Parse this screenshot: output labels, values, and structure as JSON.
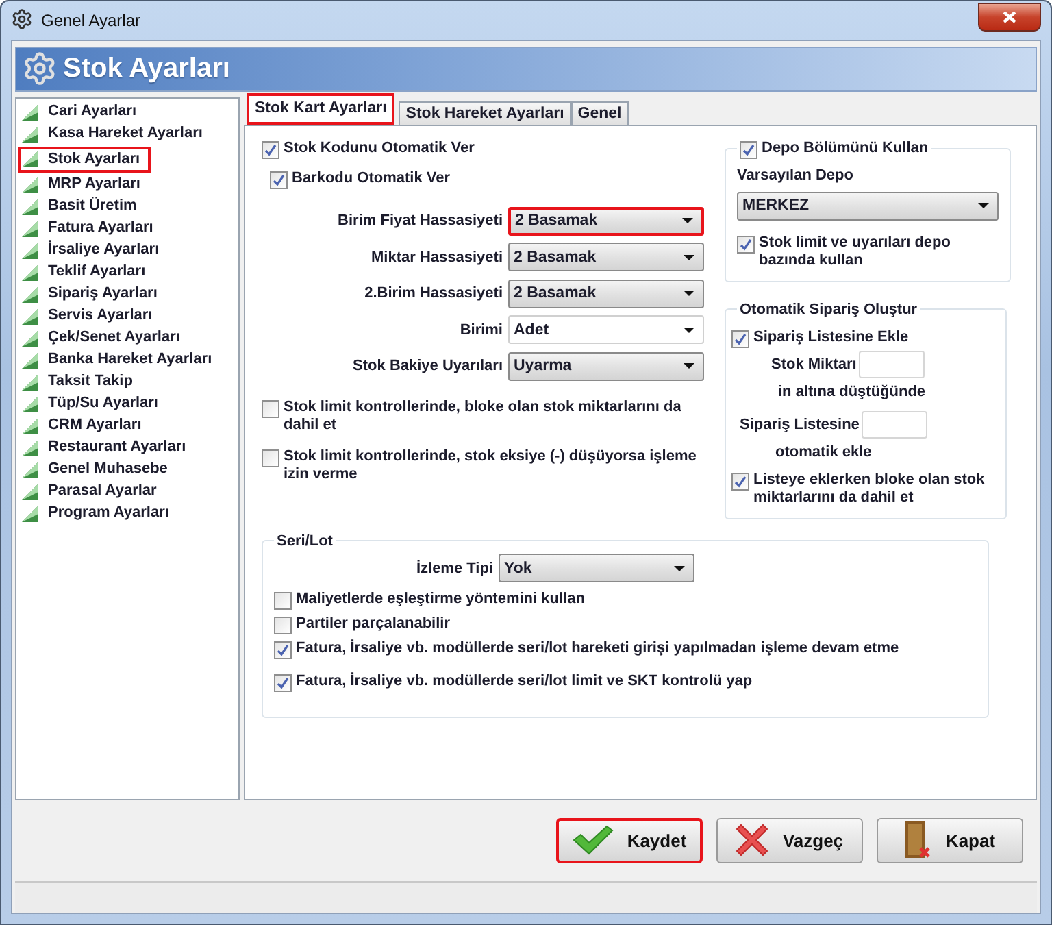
{
  "window": {
    "title": "Genel Ayarlar"
  },
  "header": {
    "title": "Stok Ayarları"
  },
  "sidebar": {
    "items": [
      {
        "label": "Cari Ayarları",
        "highlighted": false
      },
      {
        "label": "Kasa Hareket Ayarları",
        "highlighted": false
      },
      {
        "label": "Stok Ayarları",
        "highlighted": true
      },
      {
        "label": "MRP Ayarları",
        "highlighted": false
      },
      {
        "label": "Basit Üretim",
        "highlighted": false
      },
      {
        "label": "Fatura Ayarları",
        "highlighted": false
      },
      {
        "label": "İrsaliye Ayarları",
        "highlighted": false
      },
      {
        "label": "Teklif Ayarları",
        "highlighted": false
      },
      {
        "label": "Sipariş Ayarları",
        "highlighted": false
      },
      {
        "label": "Servis Ayarları",
        "highlighted": false
      },
      {
        "label": "Çek/Senet Ayarları",
        "highlighted": false
      },
      {
        "label": "Banka Hareket Ayarları",
        "highlighted": false
      },
      {
        "label": "Taksit Takip",
        "highlighted": false
      },
      {
        "label": "Tüp/Su Ayarları",
        "highlighted": false
      },
      {
        "label": "CRM Ayarları",
        "highlighted": false
      },
      {
        "label": "Restaurant Ayarları",
        "highlighted": false
      },
      {
        "label": "Genel Muhasebe",
        "highlighted": false
      },
      {
        "label": "Parasal Ayarlar",
        "highlighted": false
      },
      {
        "label": "Program Ayarları",
        "highlighted": false
      }
    ]
  },
  "tabs": [
    {
      "label": "Stok Kart Ayarları",
      "selected": true,
      "highlighted": true
    },
    {
      "label": "Stok Hareket Ayarları",
      "selected": false,
      "highlighted": false
    },
    {
      "label": "Genel",
      "selected": false,
      "highlighted": false
    }
  ],
  "general": {
    "items": [
      {
        "kind": "checkbox",
        "label": "Stok Kodunu Otomatik Ver",
        "checked": true,
        "children": [
          {
            "kind": "checkbox",
            "label": "Barkodu Otomatik Ver",
            "checked": true
          }
        ]
      },
      {
        "kind": "select",
        "label": "Birim Fiyat Hassasiyeti",
        "value": "2 Basamak",
        "editable": false,
        "highlighted": true
      },
      {
        "kind": "select",
        "label": "Miktar Hassasiyeti",
        "value": "2 Basamak",
        "editable": false,
        "highlighted": false
      },
      {
        "kind": "select",
        "label": "2.Birim Hassasiyeti",
        "value": "2 Basamak",
        "editable": false,
        "highlighted": false
      },
      {
        "kind": "select",
        "label": "Birimi",
        "value": "Adet",
        "editable": true,
        "highlighted": false
      },
      {
        "kind": "select",
        "label": "Stok Bakiye Uyarıları",
        "value": "Uyarma",
        "editable": false,
        "highlighted": false
      },
      {
        "kind": "checkbox",
        "label": "Stok limit kontrollerinde, bloke olan stok miktarlarını da dahil et",
        "checked": false
      },
      {
        "kind": "checkbox",
        "label": "Stok limit kontrollerinde, stok eksiye (-) düşüyorsa işleme izin verme",
        "checked": false
      }
    ]
  },
  "depot": {
    "enabled": {
      "label": "Depo Bölümünü Kullan",
      "checked": true
    },
    "default_label": "Varsayılan Depo",
    "default_value": "MERKEZ",
    "per_depot": {
      "label": "Stok limit ve uyarıları depo bazında kullan",
      "checked": true
    }
  },
  "auto_order": {
    "title": "Otomatik Sipariş Oluştur",
    "add": {
      "label": "Sipariş Listesine Ekle",
      "checked": true
    },
    "stock_label": "Stok Miktarı",
    "stock_suffix": "in altına düştüğünde",
    "list_label": "Sipariş Listesine",
    "list_suffix": "otomatik ekle",
    "include_blocked": {
      "label": "Listeye eklerken bloke olan stok miktarlarını da dahil et",
      "checked": true
    }
  },
  "serial_lot": {
    "title": "Seri/Lot",
    "tracking": {
      "label": "İzleme Tipi",
      "value": "Yok"
    },
    "options": [
      {
        "label": "Maliyetlerde eşleştirme yöntemini kullan",
        "checked": false
      },
      {
        "label": "Partiler parçalanabilir",
        "checked": false
      },
      {
        "label": "Fatura, İrsaliye vb. modüllerde seri/lot hareketi girişi yapılmadan işleme devam etme",
        "checked": true
      },
      {
        "label": "Fatura, İrsaliye vb. modüllerde seri/lot limit ve SKT kontrolü yap",
        "checked": true
      }
    ]
  },
  "buttons": [
    {
      "label": "Kaydet",
      "kind": "save",
      "highlighted": true
    },
    {
      "label": "Vazgeç",
      "kind": "cancel",
      "highlighted": false
    },
    {
      "label": "Kapat",
      "kind": "close",
      "highlighted": false
    }
  ]
}
